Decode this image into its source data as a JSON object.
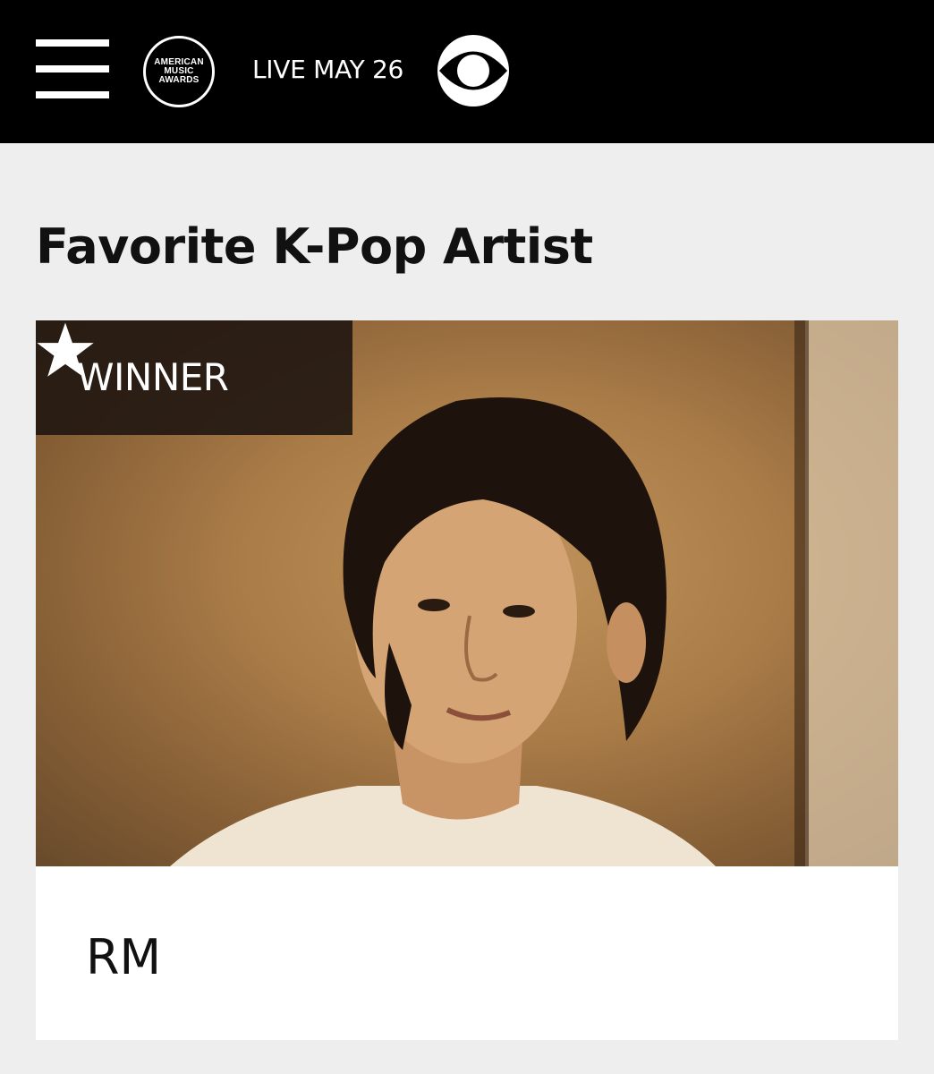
{
  "header": {
    "menu_icon": "hamburger-menu-icon",
    "logo": {
      "line1": "AMERICAN",
      "line2": "MUSIC",
      "line3": "AWARDS"
    },
    "live_text": "LIVE MAY 26",
    "network_logo_icon": "cbs-eye-icon"
  },
  "main": {
    "category_title": "Favorite K-Pop Artist",
    "nominee": {
      "badge_icon": "star-icon",
      "badge_label": "WINNER",
      "name": "RM"
    }
  },
  "colors": {
    "header_bg": "#000000",
    "page_bg": "#eeeeee",
    "badge_bg": "#231811",
    "card_bg": "#ffffff"
  }
}
